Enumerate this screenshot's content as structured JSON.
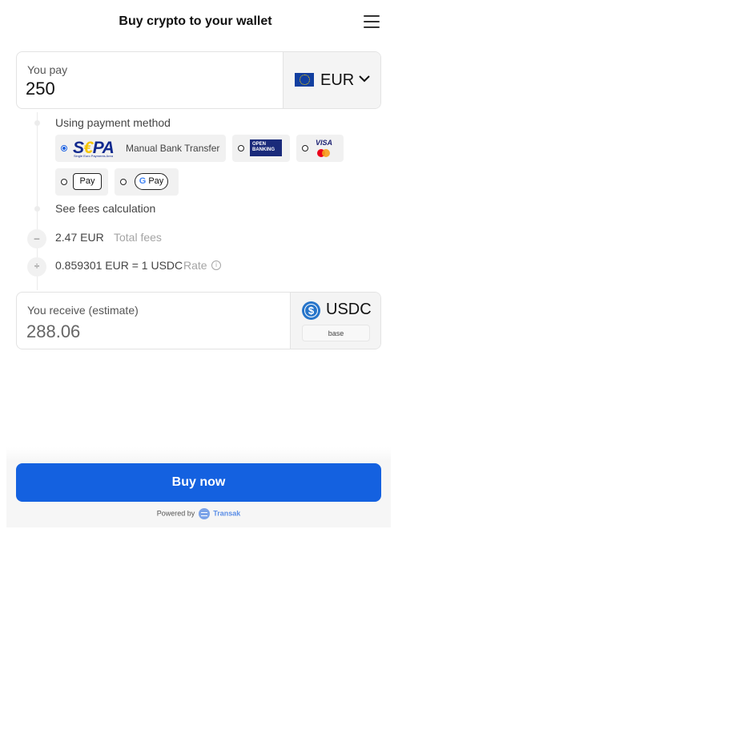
{
  "header": {
    "title": "Buy crypto to your wallet",
    "menu_icon": "hamburger-menu-icon"
  },
  "pay": {
    "label": "You pay",
    "amount": "250",
    "currency": "EUR",
    "currency_icon": "eu-flag-icon"
  },
  "payment_method": {
    "label": "Using payment method",
    "selected": "sepa",
    "options": [
      {
        "id": "sepa",
        "logo_text": "SEPA",
        "logo_subtext": "Single Euro Payments Area",
        "label": "Manual Bank Transfer",
        "selected": true
      },
      {
        "id": "open-banking",
        "logo_line1": "OPEN",
        "logo_line2": "BANKING",
        "selected": false
      },
      {
        "id": "visa-mastercard",
        "logo_text": "VISA",
        "selected": false
      },
      {
        "id": "apple-pay",
        "logo_glyph": "",
        "logo_text": "Pay",
        "selected": false
      },
      {
        "id": "google-pay",
        "logo_g": "G",
        "logo_text": "Pay",
        "selected": false
      }
    ]
  },
  "fees": {
    "link": "See fees calculation",
    "total_symbol": "–",
    "total_value": "2.47 EUR",
    "total_label": "Total fees",
    "rate_symbol": "÷",
    "rate_value": "0.859301 EUR = 1 USDC",
    "rate_label": "Rate",
    "info_glyph": "i"
  },
  "receive": {
    "label": "You receive (estimate)",
    "amount": "288.06",
    "currency": "USDC",
    "currency_icon": "usdc-icon",
    "currency_glyph": "$",
    "network": "base"
  },
  "footer": {
    "buy_label": "Buy now",
    "powered_by": "Powered by",
    "provider": "Transak"
  },
  "colors": {
    "primary": "#1461e0",
    "sepa_blue": "#10298e",
    "usdc_blue": "#2775ca"
  }
}
